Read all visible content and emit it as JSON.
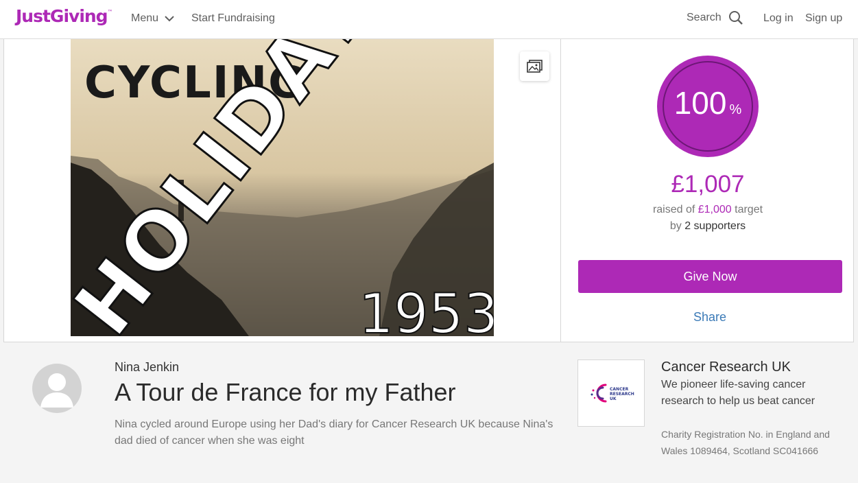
{
  "header": {
    "logo": "JustGiving",
    "logo_tm": "™",
    "menu_label": "Menu",
    "start_label": "Start Fundraising",
    "search_label": "Search",
    "login_label": "Log in",
    "signup_label": "Sign up"
  },
  "photo": {
    "line1": "CYCLING",
    "line2": "HOLIDAY",
    "line3": "1953"
  },
  "progress": {
    "percent": "100",
    "percent_symbol": "%",
    "fraction": 1.0,
    "raised": "£1,007",
    "raised_prefix": "raised of ",
    "target": "£1,000",
    "target_suffix": " target",
    "by_prefix": "by ",
    "supporters": "2 supporters"
  },
  "actions": {
    "give_label": "Give Now",
    "share_label": "Share"
  },
  "page": {
    "owner": "Nina Jenkin",
    "title": "A Tour de France for my Father",
    "summary": "Nina cycled around Europe using her Dad's diary for Cancer Research UK because Nina's dad died of cancer when she was eight"
  },
  "charity": {
    "name": "Cancer Research UK",
    "description": "We pioneer life-saving cancer research to help us beat cancer",
    "registration": "Charity Registration No. in England and Wales 1089464, Scotland SC041666",
    "logo_text": [
      "CANCER",
      "RESEARCH",
      "UK"
    ]
  },
  "colors": {
    "brand": "#ad29b6",
    "link": "#3b7ab7"
  }
}
